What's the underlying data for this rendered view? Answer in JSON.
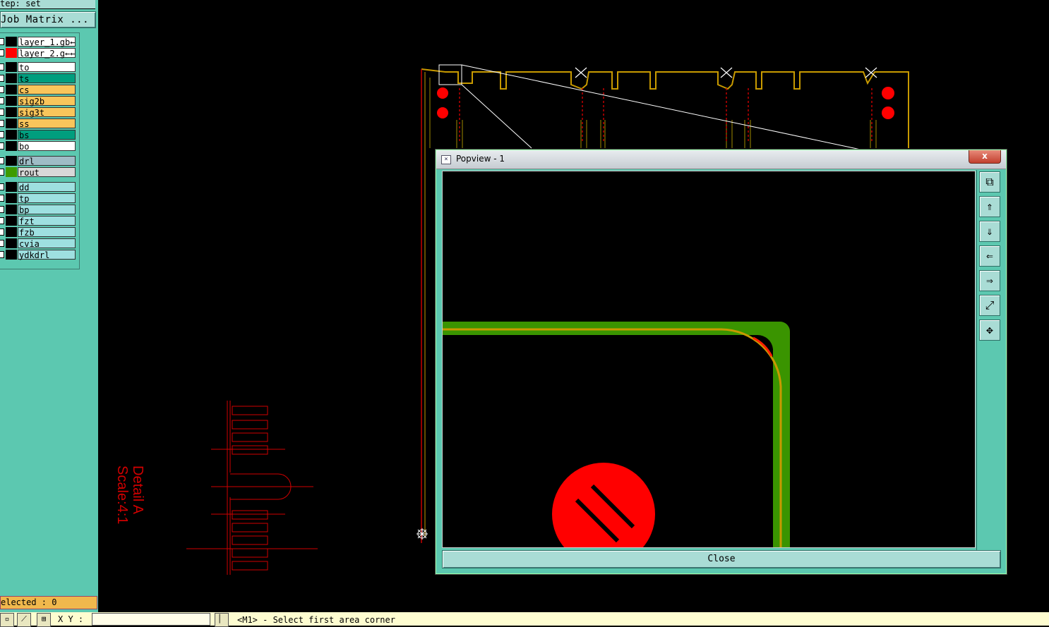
{
  "left_panel": {
    "step_label": "tep: set",
    "job_matrix_label": "Job Matrix ...",
    "layers": [
      {
        "name": "layer_1.gb←",
        "color": "#ffffff",
        "swatch": "#000000"
      },
      {
        "name": "layer_2.g←←",
        "color": "#ffffff",
        "swatch": "#ff0000"
      },
      {
        "name": "to",
        "color": "#ffffff",
        "swatch": "#000000"
      },
      {
        "name": "ts",
        "color": "#009e7e",
        "swatch": "#000000"
      },
      {
        "name": "cs",
        "color": "#f9c55b",
        "swatch": "#000000"
      },
      {
        "name": "sig2b",
        "color": "#f9c55b",
        "swatch": "#000000"
      },
      {
        "name": "sig3t",
        "color": "#f9c55b",
        "swatch": "#000000"
      },
      {
        "name": "ss",
        "color": "#f9c55b",
        "swatch": "#000000"
      },
      {
        "name": "bs",
        "color": "#009e7e",
        "swatch": "#000000"
      },
      {
        "name": "bo",
        "color": "#ffffff",
        "swatch": "#000000"
      },
      {
        "name": "drl",
        "color": "#9fbcc6",
        "swatch": "#000000"
      },
      {
        "name": "rout",
        "color": "#d8d8d8",
        "swatch": "#3d9b00"
      },
      {
        "name": "dd",
        "color": "#9ee0e0",
        "swatch": "#000000"
      },
      {
        "name": "tp",
        "color": "#9ee0e0",
        "swatch": "#000000"
      },
      {
        "name": "bp",
        "color": "#9ee0e0",
        "swatch": "#000000"
      },
      {
        "name": "fzt",
        "color": "#9ee0e0",
        "swatch": "#000000"
      },
      {
        "name": "fzb",
        "color": "#9ee0e0",
        "swatch": "#000000"
      },
      {
        "name": "cvia",
        "color": "#9ee0e0",
        "swatch": "#000000"
      },
      {
        "name": "ydkdrl",
        "color": "#9ee0e0",
        "swatch": "#000000"
      }
    ],
    "selected_label": "elected : 0"
  },
  "canvas": {
    "detail_label": "Detail A",
    "scale_label": "Scale:4:1"
  },
  "popup": {
    "title": "Popview - 1",
    "close_x": "x",
    "close_button": "Close",
    "tools": [
      "zoom-window-icon",
      "pan-up-icon",
      "pan-down-icon",
      "pan-left-icon",
      "pan-right-icon",
      "zoom-in-icon",
      "zoom-out-icon"
    ]
  },
  "bottom_bar": {
    "xy_label": "X Y :",
    "status_text": "<M1> - Select first area corner"
  }
}
